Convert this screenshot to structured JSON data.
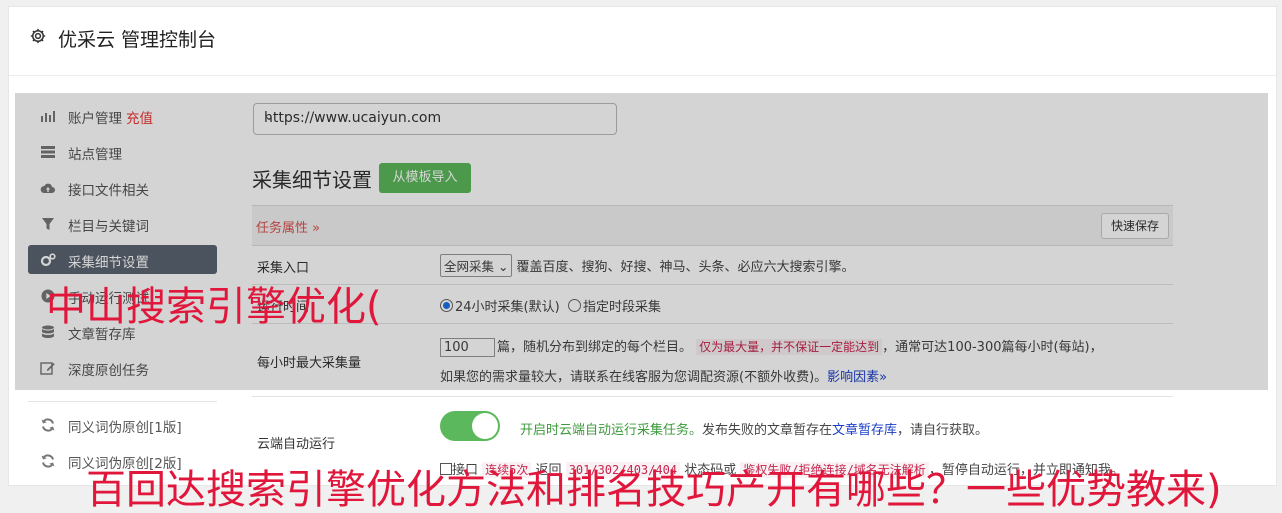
{
  "header": {
    "title": "优采云 管理控制台"
  },
  "sidebar": {
    "items": [
      {
        "label": "账户管理",
        "badge": "充值",
        "icon": "bar-chart-icon"
      },
      {
        "label": "站点管理",
        "icon": "server-icon"
      },
      {
        "label": "接口文件相关",
        "icon": "cloud-upload-icon"
      },
      {
        "label": "栏目与关键词",
        "icon": "filter-icon"
      },
      {
        "label": "采集细节设置",
        "icon": "cogs-icon",
        "active": true
      },
      {
        "label": "手动运行测试",
        "icon": "play-circle-icon"
      },
      {
        "label": "文章暂存库",
        "icon": "database-icon"
      },
      {
        "label": "深度原创任务",
        "icon": "edit-icon"
      },
      {
        "label": "同义词伪原创[1版]",
        "icon": "refresh-icon"
      },
      {
        "label": "同义词伪原创[2版]",
        "icon": "refresh-icon"
      }
    ]
  },
  "main": {
    "site_select": "https://www.ucaiyun.com",
    "section_title": "采集细节设置",
    "import_button": "从模板导入",
    "task_attr": "任务属性 »",
    "quick_save": "快速保存",
    "rows": {
      "entry": {
        "label": "采集入口",
        "select": "全网采集",
        "desc": "覆盖百度、搜狗、好搜、神马、头条、必应六大搜索引擎。"
      },
      "time": {
        "label": "运行时间",
        "opt1": "24小时采集(默认)",
        "opt2": "指定时段采集"
      },
      "max": {
        "label": "每小时最大采集量",
        "value": "100",
        "t1": "篇，随机分布到绑定的每个栏目。",
        "code": "仅为最大量，并不保证一定能达到",
        "t2": "，通常可达100-300篇每小时(每站)，",
        "t3": "如果您的需求量较大，请联系在线客服为您调配资源(不额外收费)。",
        "link": "影响因素»"
      },
      "cloud": {
        "label": "云端自动运行",
        "g1": "开启时云端自动运行采集任务。",
        "t1": "发布失败的文章暂存在",
        "link": "文章暂存库",
        "t2": "，请自行获取。",
        "cb_label": "接口",
        "c1": "连续5次",
        "t3": "返回",
        "c2": "301/302/403/404",
        "t4": "状态码或",
        "c3": "鉴权失败/拒绝连接/域名无法解析",
        "t5": "，暂停自动运行，并立即通知我。"
      }
    }
  },
  "watermark": {
    "line1": "中山搜索引擎优化(",
    "line2": "百回达搜索引擎优化方法和排名技巧产开有哪些？一些优势教来)"
  },
  "colors": {
    "accent": "#5cb85c",
    "active_nav": "#5b6471",
    "watermark": "#e0163b"
  }
}
